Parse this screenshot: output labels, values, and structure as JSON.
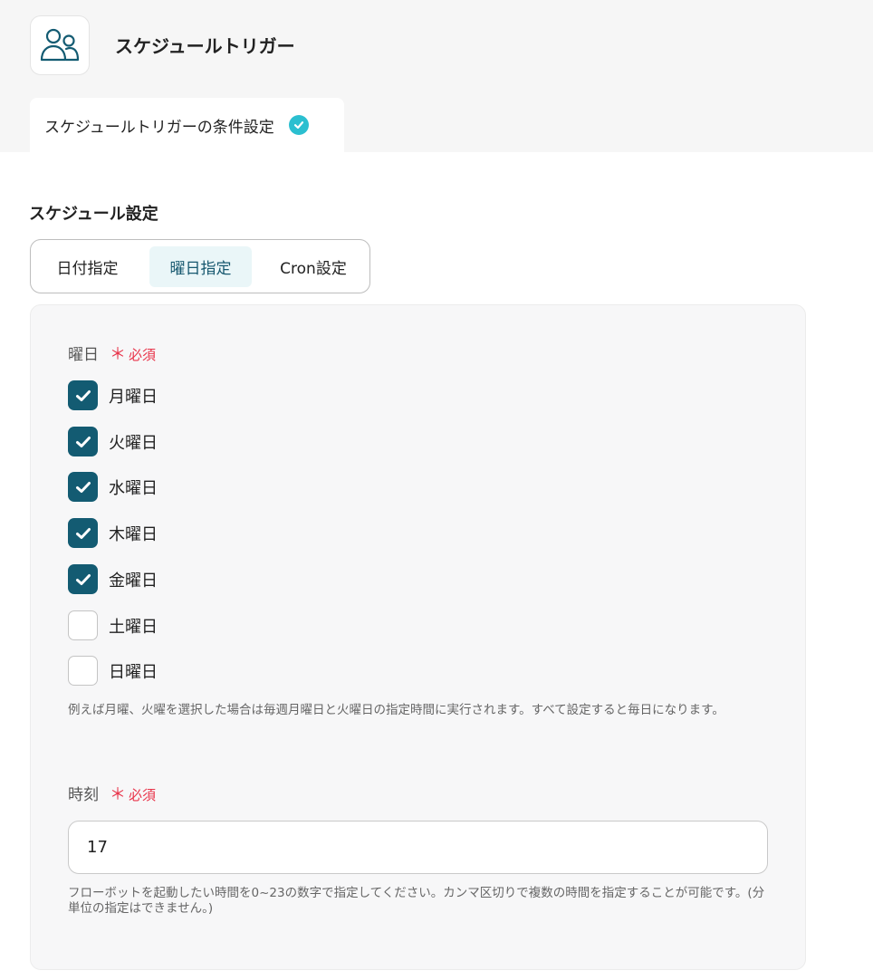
{
  "header": {
    "app_icon": "users-icon",
    "title": "スケジュールトリガー"
  },
  "step_tab": {
    "label": "スケジュールトリガーの条件設定",
    "status_icon": "check-circle-icon"
  },
  "schedule": {
    "section_title": "スケジュール設定",
    "tabs": [
      {
        "label": "日付指定",
        "active": false
      },
      {
        "label": "曜日指定",
        "active": true
      },
      {
        "label": "Cron設定",
        "active": false
      }
    ]
  },
  "weekday_field": {
    "label": "曜日",
    "required_mark": "＊",
    "required_text": "必須",
    "options": [
      {
        "label": "月曜日",
        "checked": true
      },
      {
        "label": "火曜日",
        "checked": true
      },
      {
        "label": "水曜日",
        "checked": true
      },
      {
        "label": "木曜日",
        "checked": true
      },
      {
        "label": "金曜日",
        "checked": true
      },
      {
        "label": "土曜日",
        "checked": false
      },
      {
        "label": "日曜日",
        "checked": false
      }
    ],
    "help": "例えば月曜、火曜を選択した場合は毎週月曜日と火曜日の指定時間に実行されます。すべて設定すると毎日になります。"
  },
  "time_field": {
    "label": "時刻",
    "required_mark": "＊",
    "required_text": "必須",
    "value": "17",
    "help": "フローボットを起動したい時間を0~23の数字で指定してください。カンマ区切りで複数の時間を指定することが可能です。(分単位の指定はできません。)"
  },
  "colors": {
    "accent": "#135b72",
    "check_badge": "#2bbfd0",
    "required": "#e8344a",
    "active_tab_bg": "#eaf6f8"
  }
}
